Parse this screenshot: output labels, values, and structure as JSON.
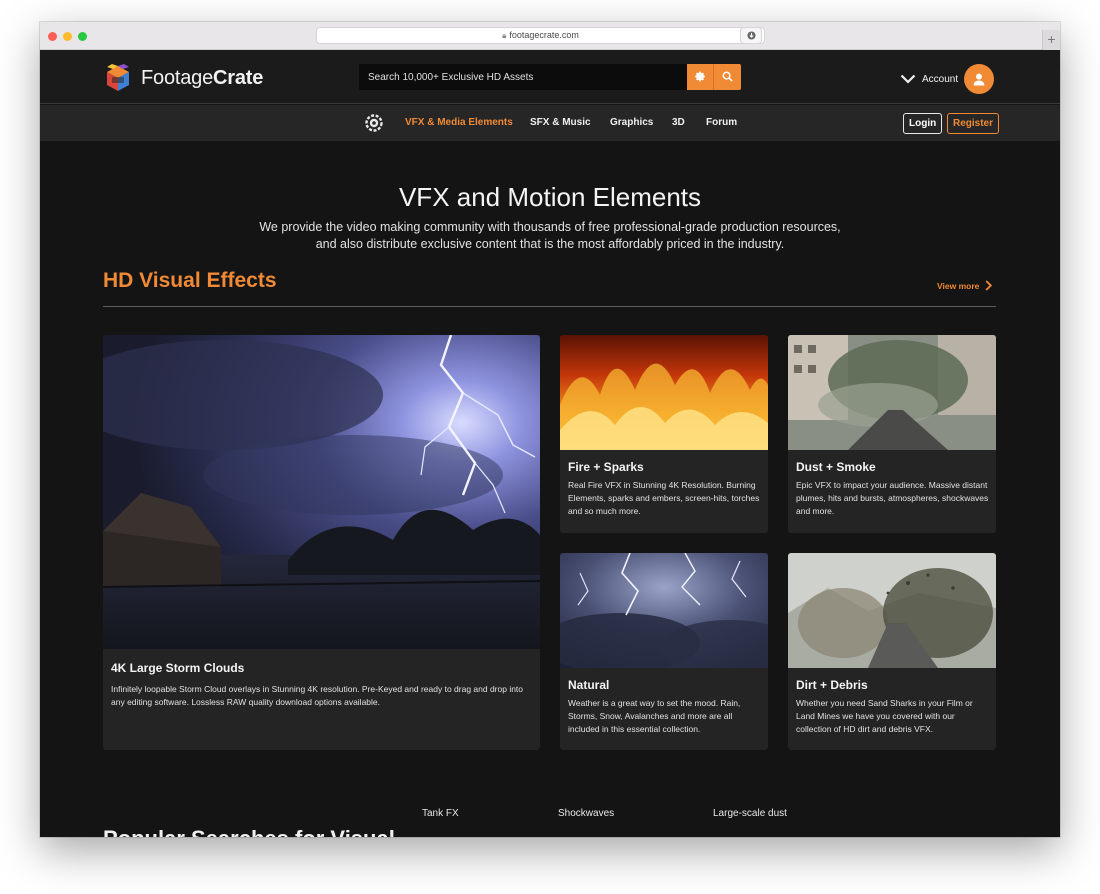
{
  "browser": {
    "url": "footagecrate.com"
  },
  "header": {
    "logo": {
      "light": "Footage",
      "bold": "Crate"
    },
    "search_placeholder": "Search 10,000+ Exclusive HD Assets",
    "account_label": "Account"
  },
  "nav": {
    "items": [
      {
        "label": "VFX & Media Elements",
        "active": true
      },
      {
        "label": "SFX & Music",
        "active": false
      },
      {
        "label": "Graphics",
        "active": false
      },
      {
        "label": "3D",
        "active": false
      },
      {
        "label": "Forum",
        "active": false
      }
    ],
    "login": "Login",
    "register": "Register"
  },
  "hero": {
    "title": "VFX and Motion Elements",
    "subtitle_line1": "We provide the video making community with thousands of free professional-grade production resources,",
    "subtitle_line2": "and also distribute exclusive content that is the most affordably priced in the industry."
  },
  "section": {
    "title": "HD Visual Effects",
    "view_more": "View more"
  },
  "cards": [
    {
      "title": "4K Large Storm Clouds",
      "desc": "Infinitely loopable Storm Cloud overlays in Stunning 4K resolution. Pre-Keyed and ready to drag and drop into any editing software. Lossless RAW quality download options available."
    },
    {
      "title": "Fire + Sparks",
      "desc": "Real Fire VFX in Stunning 4K Resolution. Burning Elements, sparks and embers, screen-hits, torches and so much more."
    },
    {
      "title": "Dust + Smoke",
      "desc": "Epic VFX to impact your audience. Massive distant plumes, hits and bursts, atmospheres, shockwaves and more."
    },
    {
      "title": "Natural",
      "desc": "Weather is a great way to set the mood. Rain, Storms, Snow, Avalanches and more are all included in this essential collection."
    },
    {
      "title": "Dirt + Debris",
      "desc": "Whether you need Sand Sharks in your Film or Land Mines we have you covered with our collection of HD dirt and debris VFX."
    }
  ],
  "popular": {
    "title": "Popular Searches for Visual",
    "labels": [
      "Tank FX",
      "Shockwaves",
      "Large-scale dust"
    ]
  },
  "colors": {
    "accent": "#f08a34",
    "background": "#141414",
    "card": "#242424"
  }
}
